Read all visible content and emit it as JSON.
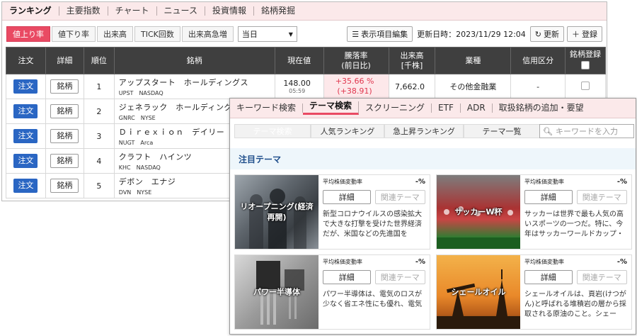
{
  "ranking_window": {
    "nav": [
      "ランキング",
      "主要指数",
      "チャート",
      "ニュース",
      "投資情報",
      "銘柄発掘"
    ],
    "tabs": [
      "値上り率",
      "値下り率",
      "出来高",
      "TICK回数",
      "出来高急増"
    ],
    "period": "当日",
    "edit_columns": "表示項目編集",
    "updated": "更新日時：2023/11/29 12:04",
    "refresh": "更新",
    "register": "登録",
    "headers": {
      "order": "注文",
      "detail": "詳細",
      "rank": "順位",
      "name": "銘柄",
      "price": "現在値",
      "change_l1": "騰落率",
      "change_l2": "(前日比)",
      "volume_l1": "出来高",
      "volume_l2": "[千株]",
      "industry": "業種",
      "margin": "信用区分",
      "watch": "銘柄登録"
    },
    "order_label": "注文",
    "detail_label": "銘柄",
    "rows": [
      {
        "rank": "1",
        "name": "アップスタート　ホールディングス",
        "sub": "UPST　NASDAQ",
        "price": "148.00",
        "time": "05:59",
        "change1": "+35.66 %",
        "change2": "(+38.91)",
        "volume": "7,662.0",
        "industry": "その他金融業",
        "margin": "-"
      },
      {
        "rank": "2",
        "name": "ジェネラック　ホールディングス",
        "sub": "GNRC　NYSE"
      },
      {
        "rank": "3",
        "name": "Ｄｉｒｅｘｉｏｎ　デイリー",
        "sub": "NUGT　Arca"
      },
      {
        "rank": "4",
        "name": "クラフト　ハインツ",
        "sub": "KHC　NASDAQ"
      },
      {
        "rank": "5",
        "name": "デボン　エナジ",
        "sub": "DVN　NYSE"
      }
    ]
  },
  "theme_window": {
    "nav": [
      "キーワード検索",
      "テーマ検索",
      "スクリーニング",
      "ETF",
      "ADR",
      "取扱銘柄の追加・要望"
    ],
    "tabs": [
      "テーマ検索",
      "人気ランキング",
      "急上昇ランキング",
      "テーマ一覧"
    ],
    "search_placeholder": "キーワードを入力",
    "featured": "注目テーマ",
    "avg_label": "平均株価変動率",
    "pct": "-%",
    "detail": "詳細",
    "related": "関連テーマ",
    "cards": [
      {
        "label": "リオープニング(経済再開)",
        "desc": "新型コロナウイルスの感染拡大で大きな打撃を受けた世界経済だが、米国などの先進国を"
      },
      {
        "label": "サッカーW杯",
        "desc": "サッカーは世界で最も人気の高いスポーツの一つだ。特に、今年はサッカーワールドカップ・"
      },
      {
        "label": "パワー半導体",
        "desc": "パワー半導体は、電気のロスが少なく省エネ性にも優れ、電気"
      },
      {
        "label": "シェールオイル",
        "desc": "シェールオイルは、頁岩(けつがん)と呼ばれる堆積岩の層から採取される原油のこと。シェー"
      }
    ]
  }
}
